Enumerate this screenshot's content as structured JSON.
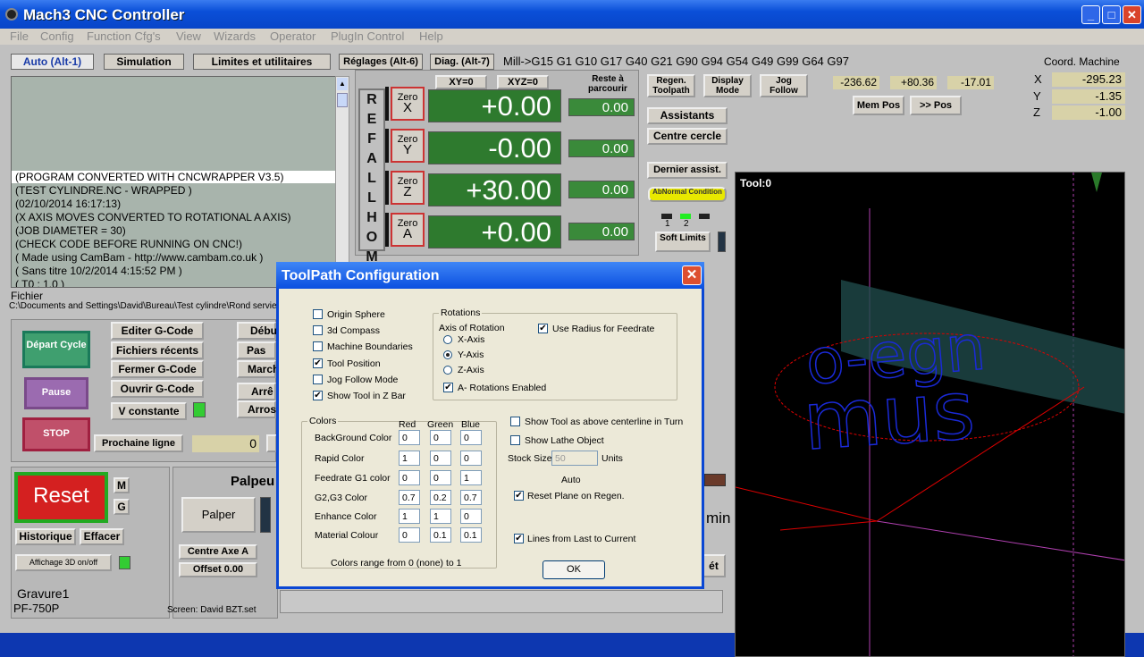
{
  "window": {
    "title": "Mach3 CNC Controller"
  },
  "menu": [
    "File",
    "Config",
    "Function Cfg's",
    "View",
    "Wizards",
    "Operator",
    "PlugIn Control",
    "Help"
  ],
  "tabs": [
    "Auto (Alt-1)",
    "Simulation",
    "Limites et utilitaires",
    "Réglages (Alt-6)",
    "Diag. (Alt-7)"
  ],
  "modal_line": "Mill->G15  G1 G10 G17 G40 G21 G90 G94 G54 G49 G99 G64 G97",
  "coord_machine": {
    "label": "Coord. Machine",
    "x": "-295.23",
    "y": "-1.35",
    "z": "-1.00",
    "axis_x": "X",
    "axis_y": "Y",
    "axis_z": "Z"
  },
  "mini_coords": [
    "-236.62",
    "+80.36",
    "-17.01"
  ],
  "mem_pos": "Mem Pos",
  "goto_pos": ">> Pos",
  "gcode_lines": [
    "(PROGRAM CONVERTED WITH CNCWRAPPER V3.5)",
    "(TEST CYLINDRE.NC - WRAPPED )",
    "(02/10/2014 16:17:13)",
    "(X AXIS MOVES CONVERTED TO ROTATIONAL A AXIS)",
    "(JOB DIAMETER = 30)",
    "(CHECK CODE BEFORE RUNNING ON CNC!)",
    "( Made using CamBam - http://www.cambam.co.uk )",
    "( Sans titre 10/2/2014 4:15:52 PM )",
    "( T0 : 1.0 )"
  ],
  "file": {
    "label": "Fichier",
    "path": "C:\\Documents and Settings\\David\\Bureau\\Test cylindre\\Rond servie"
  },
  "dro": {
    "xy0": "XY=0",
    "xyz0": "XYZ=0",
    "rest_label": "Reste à parcourir",
    "refall": "REF ALL HOME",
    "zero_label": "Zero",
    "axes": [
      {
        "axis": "X",
        "value": "+0.00",
        "rest": "0.00"
      },
      {
        "axis": "Y",
        "value": "-0.00",
        "rest": "0.00"
      },
      {
        "axis": "Z",
        "value": "+30.00",
        "rest": "0.00"
      },
      {
        "axis": "A",
        "value": "+0.00",
        "rest": "0.00"
      }
    ]
  },
  "right_buttons": {
    "regen": "Regen. Toolpath",
    "display_mode": "Display Mode",
    "jog_follow": "Jog Follow",
    "assistants": "Assistants",
    "centre_cercle": "Centre cercle",
    "dernier": "Dernier assist.",
    "abnormal": "AbNormal Condition",
    "soft_limits": "Soft Limits",
    "led1": "1",
    "led2": "2"
  },
  "tool_label": "Tool:0",
  "left_ctrl": {
    "depart": "Départ Cycle",
    "pause": "Pause",
    "stop": "STOP",
    "editer": "Editer G-Code",
    "recents": "Fichiers récents",
    "fermer": "Fermer G-Code",
    "ouvrir": "Ouvrir G-Code",
    "vconst": "V constante",
    "prochaine": "Prochaine ligne",
    "prochaine_val": "0",
    "debut": "Débu",
    "pas": "Pas à",
    "marche": "March",
    "arret": "Arrê",
    "arrosage": "Arros"
  },
  "bottom": {
    "reset": "Reset",
    "m": "M",
    "g": "G",
    "historique": "Historique",
    "effacer": "Effacer",
    "affichage": "Affichage 3D on/off",
    "palpeur": "Palpeu",
    "palper": "Palper",
    "centre_axe": "Centre Axe A",
    "offset": "Offset 0.00",
    "gravure": "Gravure1",
    "pf": "PF-750P",
    "screen": "Screen: David  BZT.set",
    "right_min": "min",
    "right_et": "ét"
  },
  "dialog": {
    "title": "ToolPath Configuration",
    "checks": [
      {
        "label": "Origin Sphere",
        "on": false
      },
      {
        "label": "3d Compass",
        "on": false
      },
      {
        "label": "Machine Boundaries",
        "on": false
      },
      {
        "label": "Tool Position",
        "on": true
      },
      {
        "label": "Jog Follow Mode",
        "on": false
      },
      {
        "label": "Show Tool in Z Bar",
        "on": true
      }
    ],
    "rotations": {
      "group": "Rotations",
      "axis_label": "Axis of Rotation",
      "radios": [
        "X-Axis",
        "Y-Axis",
        "Z-Axis"
      ],
      "selected": 1,
      "use_radius": "Use Radius for Feedrate",
      "a_rot": "A- Rotations Enabled"
    },
    "colors": {
      "group": "Colors",
      "headers": [
        "Red",
        "Green",
        "Blue"
      ],
      "rows": [
        {
          "label": "BackGround Color",
          "v": [
            "0",
            "0",
            "0"
          ]
        },
        {
          "label": "Rapid Color",
          "v": [
            "1",
            "0",
            "0"
          ]
        },
        {
          "label": "Feedrate G1 color",
          "v": [
            "0",
            "0",
            "1"
          ]
        },
        {
          "label": "G2,G3 Color",
          "v": [
            "0.7",
            "0.2",
            "0.7"
          ]
        },
        {
          "label": "Enhance Color",
          "v": [
            "1",
            "1",
            "0"
          ]
        },
        {
          "label": "Material Colour",
          "v": [
            "0",
            "0.1",
            "0.1"
          ]
        }
      ],
      "range_note": "Colors range from 0 (none) to 1"
    },
    "show_tool_above": "Show Tool as above centerline in Turn",
    "show_lathe": "Show Lathe Object",
    "stock_size": "Stock Size",
    "stock_val": "50",
    "units": "Units",
    "auto": "Auto",
    "reset_plane": "Reset Plane on Regen.",
    "lines_last": "Lines from Last to Current",
    "ok": "OK"
  }
}
